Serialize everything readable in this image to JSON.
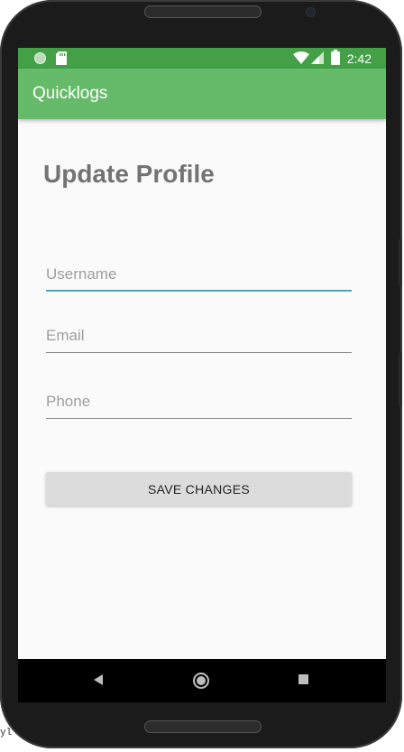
{
  "status_bar": {
    "time": "2:42",
    "left_icons": [
      "circle-icon",
      "sd-card-icon"
    ],
    "right_icons": [
      "wifi-icon",
      "cell-signal-icon",
      "battery-icon"
    ]
  },
  "app_bar": {
    "title": "Quicklogs"
  },
  "form": {
    "title": "Update Profile",
    "username_placeholder": "Username",
    "username_value": "",
    "email_placeholder": "Email",
    "email_value": "",
    "phone_placeholder": "Phone",
    "phone_value": "",
    "save_label": "SAVE CHANGES"
  },
  "nav_bar": {
    "icons": [
      "back-icon",
      "home-icon",
      "recents-icon"
    ]
  },
  "colors": {
    "status_bar": "#43a047",
    "app_bar": "#66bb6a",
    "focus_accent": "#4fa3c7",
    "button_bg": "#dcdcdc"
  },
  "corner_fragment": "yl"
}
